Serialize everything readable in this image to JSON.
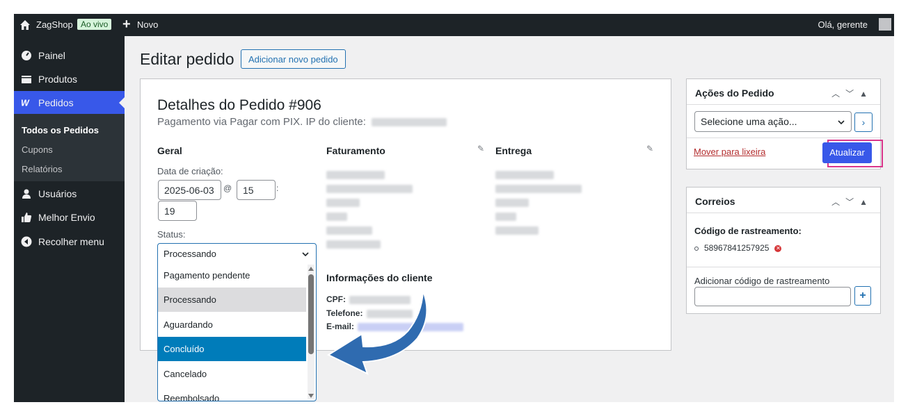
{
  "adminbar": {
    "site_name": "ZagShop",
    "live_badge": "Ao vivo",
    "new_label": "Novo",
    "greeting": "Olá, gerente"
  },
  "sidebar": {
    "items": [
      {
        "label": "Painel",
        "icon": "dashboard-icon"
      },
      {
        "label": "Produtos",
        "icon": "products-icon"
      },
      {
        "label": "Pedidos",
        "icon": "woo-icon"
      },
      {
        "label": "Usuários",
        "icon": "user-icon"
      },
      {
        "label": "Melhor Envio",
        "icon": "thumbs-up-icon"
      },
      {
        "label": "Recolher menu",
        "icon": "collapse-icon"
      }
    ],
    "submenu": [
      "Todos os Pedidos",
      "Cupons",
      "Relatórios"
    ]
  },
  "header": {
    "title": "Editar pedido",
    "add_button": "Adicionar novo pedido"
  },
  "order": {
    "title": "Detalhes do Pedido #906",
    "subtitle": "Pagamento via Pagar com PIX. IP do cliente:",
    "general_title": "Geral",
    "billing_title": "Faturamento",
    "shipping_title": "Entrega",
    "created_label": "Data de criação:",
    "date_value": "2025-06-03",
    "at": "@",
    "hour_value": "15",
    "colon": ":",
    "minute_value": "19",
    "status_label": "Status:",
    "status_value": "Processando",
    "status_options": [
      "Pagamento pendente",
      "Processando",
      "Aguardando",
      "Concluído",
      "Cancelado",
      "Reembolsado"
    ],
    "customer_info_title": "Informações do cliente",
    "cpf_label": "CPF:",
    "phone_label": "Telefone:",
    "email_label": "E-mail:"
  },
  "actions_box": {
    "title": "Ações do Pedido",
    "select_placeholder": "Selecione uma ação...",
    "trash_link": "Mover para lixeira",
    "update_button": "Atualizar"
  },
  "correios_box": {
    "title": "Correios",
    "tracking_label": "Código de rastreamento:",
    "tracking_code": "58967841257925",
    "add_label": "Adicionar código de rastreamento"
  },
  "colors": {
    "accent": "#3858e9",
    "link": "#2271b1",
    "selected_option": "#007cba",
    "highlight_border": "#d9368b"
  }
}
